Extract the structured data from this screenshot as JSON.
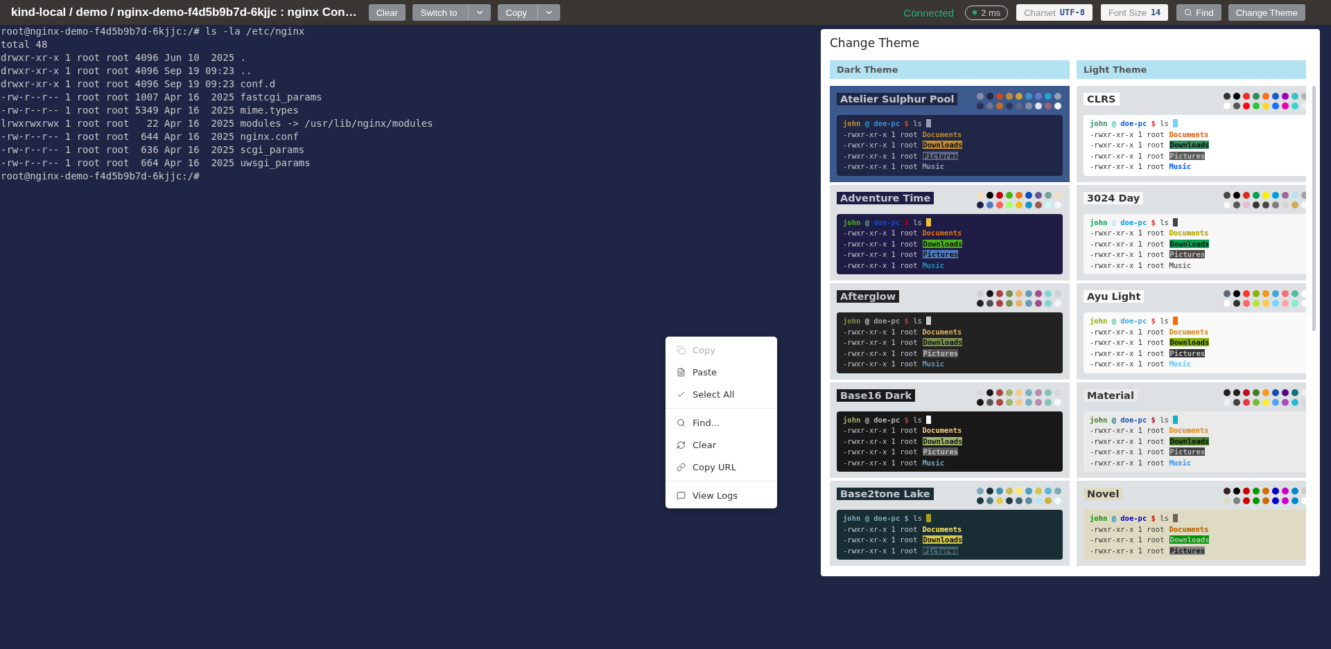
{
  "header": {
    "title": "kind-local / demo / nginx-demo-f4d5b9b7d-6kjjc : nginx Con…",
    "actions": [
      {
        "label": "Clear",
        "kind": "plain"
      },
      {
        "label": "Switch to",
        "kind": "split"
      },
      {
        "label": "Copy",
        "kind": "split"
      }
    ],
    "status": "Connected",
    "latency": "2 ms",
    "settings": [
      {
        "label": "Charset",
        "value": "UTF-8"
      },
      {
        "label": "Font Size",
        "value": "14"
      }
    ],
    "tools": [
      {
        "label": "Find",
        "kind": "search"
      },
      {
        "label": "Change Theme",
        "kind": "plain"
      }
    ]
  },
  "terminal": {
    "lines": [
      "root@nginx-demo-f4d5b9b7d-6kjjc:/# ls -la /etc/nginx",
      "total 48",
      "drwxr-xr-x 1 root root 4096 Jun 10  2025 .",
      "drwxr-xr-x 1 root root 4096 Sep 19 09:23 ..",
      "drwxr-xr-x 1 root root 4096 Sep 19 09:23 conf.d",
      "-rw-r--r-- 1 root root 1007 Apr 16  2025 fastcgi_params",
      "-rw-r--r-- 1 root root 5349 Apr 16  2025 mime.types",
      "lrwxrwxrwx 1 root root   22 Apr 16  2025 modules -> /usr/lib/nginx/modules",
      "-rw-r--r-- 1 root root  644 Apr 16  2025 nginx.conf",
      "-rw-r--r-- 1 root root  636 Apr 16  2025 scgi_params",
      "-rw-r--r-- 1 root root  664 Apr 16  2025 uwsgi_params",
      "root@nginx-demo-f4d5b9b7d-6kjjc:/#"
    ]
  },
  "context_menu": {
    "groups": [
      [
        {
          "label": "Copy",
          "disabled": true
        },
        {
          "label": "Paste",
          "disabled": false
        },
        {
          "label": "Select All",
          "disabled": false
        }
      ],
      [
        {
          "label": "Find...",
          "disabled": false
        },
        {
          "label": "Clear",
          "disabled": false
        },
        {
          "label": "Copy URL",
          "disabled": false
        }
      ],
      [
        {
          "label": "View Logs",
          "disabled": false
        }
      ]
    ]
  },
  "theme_panel": {
    "title": "Change Theme",
    "columns": [
      {
        "title": "Dark Theme",
        "themes": [
          {
            "name": "Atelier Sulphur Pool",
            "selected": true,
            "preview": {
              "color": "#202746"
            },
            "cursor": {
              "color": "#979db4"
            },
            "palette": [
              {
                "color": "#898ea4"
              },
              {
                "color": "#202746"
              },
              {
                "color": "#c94922"
              },
              {
                "color": "#c08b30"
              },
              {
                "color": "#d0a030"
              },
              {
                "color": "#3d8fd1"
              },
              {
                "color": "#6679cc"
              },
              {
                "color": "#22a2c9"
              },
              {
                "color": "#979db4"
              },
              {
                "color": "#293256"
              },
              {
                "color": "#6b7394"
              },
              {
                "color": "#c76b29"
              },
              {
                "color": "#2c3560"
              },
              {
                "color": "#5e6687"
              },
              {
                "color": "#898ea4"
              },
              {
                "color": "#dfe2f1"
              },
              {
                "color": "#9c637a"
              },
              {
                "color": "#f5f7ff"
              }
            ],
            "prompt": [
              {
                "text": "john",
                "color": "#c08b30"
              },
              {
                "text": "@",
                "color": "#22a2c9"
              },
              {
                "text": "doe-pc",
                "color": "#3d8fd1"
              },
              {
                "text": "$",
                "color": "#c94922"
              }
            ],
            "command": "ls",
            "lines": [
              {
                "perm": "-rwxr-xr-x 1 root",
                "file": {
                  "text": "Documents",
                  "kind": "bold",
                  "color": "#c08b30"
                }
              },
              {
                "perm": "-rwxr-xr-x 1 root",
                "file": {
                  "text": "Downloads",
                  "kind": "highlight",
                  "color": "#c08b30"
                }
              },
              {
                "perm": "-rwxr-xr-x 1 root",
                "file": {
                  "text": "Pictures",
                  "kind": "highlight",
                  "color": "#5e6687"
                }
              },
              {
                "perm": "-rwxr-xr-x 1 root",
                "file": {
                  "text": "Music",
                  "kind": "bold",
                  "color": "#979db4"
                }
              }
            ]
          },
          {
            "name": "Adventure Time",
            "selected": false,
            "preview": {
              "color": "#1f1d45"
            },
            "cursor": {
              "color": "#efbf38"
            },
            "palette": [
              {
                "color": "#f8dcc0"
              },
              {
                "color": "#050404"
              },
              {
                "color": "#bd0013"
              },
              {
                "color": "#4ab118"
              },
              {
                "color": "#e7741e"
              },
              {
                "color": "#0f4ac6"
              },
              {
                "color": "#665993"
              },
              {
                "color": "#70a598"
              },
              {
                "color": "#f8dcc0"
              },
              {
                "color": "#1f1d45"
              },
              {
                "color": "#4e7cbf"
              },
              {
                "color": "#fc5f5a"
              },
              {
                "color": "#9eff6e"
              },
              {
                "color": "#efc11a"
              },
              {
                "color": "#1997c6"
              },
              {
                "color": "#9b5953"
              },
              {
                "color": "#c8faf4"
              },
              {
                "color": "#f6f5fb"
              }
            ],
            "prompt": [
              {
                "text": "john",
                "color": "#4ab118"
              },
              {
                "text": "@",
                "color": "#70a598"
              },
              {
                "text": "doe-pc",
                "color": "#0f4ac6"
              },
              {
                "text": "$",
                "color": "#bd0013"
              }
            ],
            "command": "ls",
            "lines": [
              {
                "perm": "-rwxr-xr-x 1 root",
                "file": {
                  "text": "Documents",
                  "kind": "bold",
                  "color": "#e7741e"
                }
              },
              {
                "perm": "-rwxr-xr-x 1 root",
                "file": {
                  "text": "Downloads",
                  "kind": "highlight",
                  "color": "#4ab118"
                }
              },
              {
                "perm": "-rwxr-xr-x 1 root",
                "file": {
                  "text": "Pictures",
                  "kind": "highlight",
                  "color": "#4e7cbf"
                }
              },
              {
                "perm": "-rwxr-xr-x 1 root",
                "file": {
                  "text": "Music",
                  "kind": "bold",
                  "color": "#1997c6"
                }
              }
            ]
          },
          {
            "name": "Afterglow",
            "selected": false,
            "preview": {
              "color": "#222222"
            },
            "cursor": {
              "color": "#d0d0d0"
            },
            "palette": [
              {
                "color": "#d0d0d0"
              },
              {
                "color": "#151515"
              },
              {
                "color": "#ac4142"
              },
              {
                "color": "#7e8e50"
              },
              {
                "color": "#e5b567"
              },
              {
                "color": "#6c99bb"
              },
              {
                "color": "#9f4e85"
              },
              {
                "color": "#7dd6cf"
              },
              {
                "color": "#d0d0d0"
              },
              {
                "color": "#222222"
              },
              {
                "color": "#505050"
              },
              {
                "color": "#ac4142"
              },
              {
                "color": "#7e8e50"
              },
              {
                "color": "#e5b567"
              },
              {
                "color": "#6c99bb"
              },
              {
                "color": "#9f4e85"
              },
              {
                "color": "#7dd6cf"
              },
              {
                "color": "#f5f5f5"
              }
            ],
            "prompt": [
              {
                "text": "john",
                "color": "#7e8e50"
              },
              {
                "text": "@",
                "color": "#d0d0d0"
              },
              {
                "text": "doe-pc",
                "color": "#a0a0a0"
              },
              {
                "text": "$",
                "color": "#ac4142"
              }
            ],
            "command": "ls",
            "lines": [
              {
                "perm": "-rwxr-xr-x 1 root",
                "file": {
                  "text": "Documents",
                  "kind": "bold",
                  "color": "#e5b567"
                }
              },
              {
                "perm": "-rwxr-xr-x 1 root",
                "file": {
                  "text": "Downloads",
                  "kind": "highlight",
                  "color": "#7e8e50"
                }
              },
              {
                "perm": "-rwxr-xr-x 1 root",
                "file": {
                  "text": "Pictures",
                  "kind": "highlight",
                  "color": "#505050"
                }
              },
              {
                "perm": "-rwxr-xr-x 1 root",
                "file": {
                  "text": "Music",
                  "kind": "bold",
                  "color": "#6c99bb"
                }
              }
            ]
          },
          {
            "name": "Base16 Dark",
            "selected": false,
            "preview": {
              "color": "#181818"
            },
            "cursor": {
              "color": "#f8f8f8"
            },
            "palette": [
              {
                "color": "#d8d8d8"
              },
              {
                "color": "#181818"
              },
              {
                "color": "#ab4642"
              },
              {
                "color": "#a1b56c"
              },
              {
                "color": "#f7ca88"
              },
              {
                "color": "#7cafc2"
              },
              {
                "color": "#ba8baf"
              },
              {
                "color": "#86c1b9"
              },
              {
                "color": "#d8d8d8"
              },
              {
                "color": "#181818"
              },
              {
                "color": "#585858"
              },
              {
                "color": "#ab4642"
              },
              {
                "color": "#a1b56c"
              },
              {
                "color": "#f7ca88"
              },
              {
                "color": "#7cafc2"
              },
              {
                "color": "#ba8baf"
              },
              {
                "color": "#86c1b9"
              },
              {
                "color": "#f8f8f8"
              }
            ],
            "prompt": [
              {
                "text": "john",
                "color": "#a1b56c"
              },
              {
                "text": "@",
                "color": "#b8b8b8"
              },
              {
                "text": "doe-pc",
                "color": "#b8b8b8"
              },
              {
                "text": "$",
                "color": "#ab4642"
              }
            ],
            "command": "ls",
            "lines": [
              {
                "perm": "-rwxr-xr-x 1 root",
                "file": {
                  "text": "Documents",
                  "kind": "bold",
                  "color": "#f7ca88"
                }
              },
              {
                "perm": "-rwxr-xr-x 1 root",
                "file": {
                  "text": "Downloads",
                  "kind": "highlight",
                  "color": "#a1b56c"
                }
              },
              {
                "perm": "-rwxr-xr-x 1 root",
                "file": {
                  "text": "Pictures",
                  "kind": "highlight",
                  "color": "#585858"
                }
              },
              {
                "perm": "-rwxr-xr-x 1 root",
                "file": {
                  "text": "Music",
                  "kind": "bold",
                  "color": "#7cafc2"
                }
              }
            ]
          },
          {
            "name": "Base2tone Lake",
            "selected": false,
            "preview": {
              "color": "#192d34"
            },
            "cursor": {
              "color": "#aa9a1e"
            },
            "palette": [
              {
                "color": "#7ba8b7"
              },
              {
                "color": "#192d34"
              },
              {
                "color": "#3e91ac"
              },
              {
                "color": "#cbbb4d"
              },
              {
                "color": "#ffeb66"
              },
              {
                "color": "#499fbc"
              },
              {
                "color": "#d3c64b"
              },
              {
                "color": "#5ab8d8"
              },
              {
                "color": "#7ba8b7"
              },
              {
                "color": "#1e353d"
              },
              {
                "color": "#4d7783"
              },
              {
                "color": "#e0cb4c"
              },
              {
                "color": "#203841"
              },
              {
                "color": "#3c6370"
              },
              {
                "color": "#5a8c9c"
              },
              {
                "color": "#b9e7f5"
              },
              {
                "color": "#cab53d"
              },
              {
                "color": "#f0fbff"
              }
            ],
            "prompt": [
              {
                "text": "john",
                "color": "#7ba8b7"
              },
              {
                "text": "@",
                "color": "#7ba8b7"
              },
              {
                "text": "doe-pc",
                "color": "#7ba8b7"
              },
              {
                "text": "$",
                "color": "#7ba8b7"
              }
            ],
            "command": "ls",
            "lines": [
              {
                "perm": "-rwxr-xr-x 1 root",
                "file": {
                  "text": "Documents",
                  "kind": "bold",
                  "color": "#ffeb66"
                }
              },
              {
                "perm": "-rwxr-xr-x 1 root",
                "file": {
                  "text": "Downloads",
                  "kind": "highlight",
                  "color": "#d3c64b"
                }
              },
              {
                "perm": "-rwxr-xr-x 1 root",
                "file": {
                  "text": "Pictures",
                  "kind": "highlight",
                  "color": "#3e6470"
                }
              }
            ]
          }
        ]
      },
      {
        "title": "Light Theme",
        "themes": [
          {
            "name": "CLRS",
            "selected": false,
            "preview": {
              "color": "#ffffff"
            },
            "cursor": {
              "color": "#6fd3fc"
            },
            "palette": [
              {
                "color": "#333333"
              },
              {
                "color": "#000000"
              },
              {
                "color": "#f8282a"
              },
              {
                "color": "#328a5d"
              },
              {
                "color": "#fa701d"
              },
              {
                "color": "#135cd0"
              },
              {
                "color": "#9f00bd"
              },
              {
                "color": "#33c3c1"
              },
              {
                "color": "#b3b3b3"
              },
              {
                "color": "#ffffff"
              },
              {
                "color": "#555753"
              },
              {
                "color": "#fb0416"
              },
              {
                "color": "#2cc631"
              },
              {
                "color": "#fdd727"
              },
              {
                "color": "#1670ff"
              },
              {
                "color": "#e900b0"
              },
              {
                "color": "#3ad5ce"
              },
              {
                "color": "#eeeeec"
              }
            ],
            "prompt": [
              {
                "text": "john",
                "color": "#328a5d"
              },
              {
                "text": "@",
                "color": "#33c3c1"
              },
              {
                "text": "doe-pc",
                "color": "#135cd0"
              },
              {
                "text": "$",
                "color": "#f8282a"
              }
            ],
            "command": "ls",
            "lines": [
              {
                "perm": "-rwxr-xr-x 1 root",
                "file": {
                  "text": "Documents",
                  "kind": "bold",
                  "color": "#fa701d"
                }
              },
              {
                "perm": "-rwxr-xr-x 1 root",
                "file": {
                  "text": "Downloads",
                  "kind": "highlight",
                  "color": "#328a5d"
                }
              },
              {
                "perm": "-rwxr-xr-x 1 root",
                "file": {
                  "text": "Pictures",
                  "kind": "highlight",
                  "color": "#555753"
                }
              },
              {
                "perm": "-rwxr-xr-x 1 root",
                "file": {
                  "text": "Music",
                  "kind": "bold",
                  "color": "#1670ff"
                }
              }
            ]
          },
          {
            "name": "3024 Day",
            "selected": false,
            "preview": {
              "color": "#f7f7f7"
            },
            "cursor": {
              "color": "#4a4543"
            },
            "palette": [
              {
                "color": "#4a4543"
              },
              {
                "color": "#090300"
              },
              {
                "color": "#db2d20"
              },
              {
                "color": "#01a252"
              },
              {
                "color": "#fded02"
              },
              {
                "color": "#01a0e4"
              },
              {
                "color": "#a16a94"
              },
              {
                "color": "#b5e4f4"
              },
              {
                "color": "#a5a2a2"
              },
              {
                "color": "#f7f7f7"
              },
              {
                "color": "#5c5855"
              },
              {
                "color": "#e8bbd0"
              },
              {
                "color": "#3a3432"
              },
              {
                "color": "#4a4543"
              },
              {
                "color": "#807d7c"
              },
              {
                "color": "#d6d5d4"
              },
              {
                "color": "#cdab53"
              },
              {
                "color": "#f7f7f7"
              }
            ],
            "prompt": [
              {
                "text": "john",
                "color": "#01a252"
              },
              {
                "text": "@",
                "color": "#b5e4f4"
              },
              {
                "text": "doe-pc",
                "color": "#01a0e4"
              },
              {
                "text": "$",
                "color": "#db2d20"
              }
            ],
            "command": "ls",
            "lines": [
              {
                "perm": "-rwxr-xr-x 1 root",
                "file": {
                  "text": "Documents",
                  "kind": "bold",
                  "color": "#c9b800"
                }
              },
              {
                "perm": "-rwxr-xr-x 1 root",
                "file": {
                  "text": "Downloads",
                  "kind": "highlight",
                  "color": "#01a252"
                }
              },
              {
                "perm": "-rwxr-xr-x 1 root",
                "file": {
                  "text": "Pictures",
                  "kind": "highlight",
                  "color": "#4a4543"
                }
              },
              {
                "perm": "-rwxr-xr-x 1 root",
                "file": {
                  "text": "Music",
                  "kind": "plain",
                  "color": "#4a4543"
                }
              }
            ]
          },
          {
            "name": "Ayu Light",
            "selected": false,
            "preview": {
              "color": "#fafafa"
            },
            "cursor": {
              "color": "#ff6a00"
            },
            "palette": [
              {
                "color": "#5c6773"
              },
              {
                "color": "#000000"
              },
              {
                "color": "#ff3333"
              },
              {
                "color": "#86b300"
              },
              {
                "color": "#f29718"
              },
              {
                "color": "#41a6d9"
              },
              {
                "color": "#f07178"
              },
              {
                "color": "#4dbf99"
              },
              {
                "color": "#ffffff"
              },
              {
                "color": "#ffffff"
              },
              {
                "color": "#323232"
              },
              {
                "color": "#ff6565"
              },
              {
                "color": "#b8e532"
              },
              {
                "color": "#ffc94a"
              },
              {
                "color": "#73d8ff"
              },
              {
                "color": "#ffa3aa"
              },
              {
                "color": "#7ff1cb"
              },
              {
                "color": "#ffffff"
              }
            ],
            "prompt": [
              {
                "text": "john",
                "color": "#86b300"
              },
              {
                "text": "@",
                "color": "#4dbf99"
              },
              {
                "text": "doe-pc",
                "color": "#41a6d9"
              },
              {
                "text": "$",
                "color": "#ff3333"
              }
            ],
            "command": "ls",
            "lines": [
              {
                "perm": "-rwxr-xr-x 1 root",
                "file": {
                  "text": "Documents",
                  "kind": "bold",
                  "color": "#f29718"
                }
              },
              {
                "perm": "-rwxr-xr-x 1 root",
                "file": {
                  "text": "Downloads",
                  "kind": "highlight",
                  "color": "#86b300"
                }
              },
              {
                "perm": "-rwxr-xr-x 1 root",
                "file": {
                  "text": "Pictures",
                  "kind": "highlight",
                  "color": "#323232"
                }
              },
              {
                "perm": "-rwxr-xr-x 1 root",
                "file": {
                  "text": "Music",
                  "kind": "bold",
                  "color": "#73d8ff"
                }
              }
            ]
          },
          {
            "name": "Material",
            "selected": false,
            "preview": {
              "color": "#eaeaea"
            },
            "cursor": {
              "color": "#16afca"
            },
            "palette": [
              {
                "color": "#212121"
              },
              {
                "color": "#212121"
              },
              {
                "color": "#b7141f"
              },
              {
                "color": "#457b24"
              },
              {
                "color": "#f6981e"
              },
              {
                "color": "#134eb2"
              },
              {
                "color": "#560088"
              },
              {
                "color": "#0e717c"
              },
              {
                "color": "#efefef"
              },
              {
                "color": "#efefef"
              },
              {
                "color": "#424242"
              },
              {
                "color": "#e83b3f"
              },
              {
                "color": "#7aba3a"
              },
              {
                "color": "#ffea2e"
              },
              {
                "color": "#54a4f3"
              },
              {
                "color": "#aa4dbc"
              },
              {
                "color": "#26bbd1"
              },
              {
                "color": "#d9d9d9"
              }
            ],
            "prompt": [
              {
                "text": "john",
                "color": "#457b24"
              },
              {
                "text": "@",
                "color": "#0e717c"
              },
              {
                "text": "doe-pc",
                "color": "#134eb2"
              },
              {
                "text": "$",
                "color": "#b7141f"
              }
            ],
            "command": "ls",
            "lines": [
              {
                "perm": "-rwxr-xr-x 1 root",
                "file": {
                  "text": "Documents",
                  "kind": "bold",
                  "color": "#f6981e"
                }
              },
              {
                "perm": "-rwxr-xr-x 1 root",
                "file": {
                  "text": "Downloads",
                  "kind": "highlight",
                  "color": "#457b24"
                }
              },
              {
                "perm": "-rwxr-xr-x 1 root",
                "file": {
                  "text": "Pictures",
                  "kind": "highlight",
                  "color": "#424242"
                }
              },
              {
                "perm": "-rwxr-xr-x 1 root",
                "file": {
                  "text": "Music",
                  "kind": "bold",
                  "color": "#54a4f3"
                }
              }
            ]
          },
          {
            "name": "Novel",
            "selected": false,
            "preview": {
              "color": "#dfdbc3"
            },
            "cursor": {
              "color": "#73635a"
            },
            "palette": [
              {
                "color": "#3b2322"
              },
              {
                "color": "#000000"
              },
              {
                "color": "#cc0000"
              },
              {
                "color": "#009600"
              },
              {
                "color": "#d06b00"
              },
              {
                "color": "#0000cc"
              },
              {
                "color": "#cc00cc"
              },
              {
                "color": "#0087cc"
              },
              {
                "color": "#cccccc"
              },
              {
                "color": "#dfdbc3"
              },
              {
                "color": "#808080"
              },
              {
                "color": "#cc0000"
              },
              {
                "color": "#009600"
              },
              {
                "color": "#d06b00"
              },
              {
                "color": "#0000cc"
              },
              {
                "color": "#cc00cc"
              },
              {
                "color": "#0087cc"
              },
              {
                "color": "#ffffff"
              }
            ],
            "prompt": [
              {
                "text": "john",
                "color": "#009600"
              },
              {
                "text": "@",
                "color": "#0087cc"
              },
              {
                "text": "doe-pc",
                "color": "#0000cc"
              },
              {
                "text": "$",
                "color": "#cc0000"
              }
            ],
            "command": "ls",
            "lines": [
              {
                "perm": "-rwxr-xr-x 1 root",
                "file": {
                  "text": "Documents",
                  "kind": "bold",
                  "color": "#d06b00"
                }
              },
              {
                "perm": "-rwxr-xr-x 1 root",
                "file": {
                  "text": "Downloads",
                  "kind": "highlight",
                  "color": "#009600"
                }
              },
              {
                "perm": "-rwxr-xr-x 1 root",
                "file": {
                  "text": "Pictures",
                  "kind": "highlight",
                  "color": "#808080"
                }
              }
            ]
          }
        ]
      }
    ]
  }
}
